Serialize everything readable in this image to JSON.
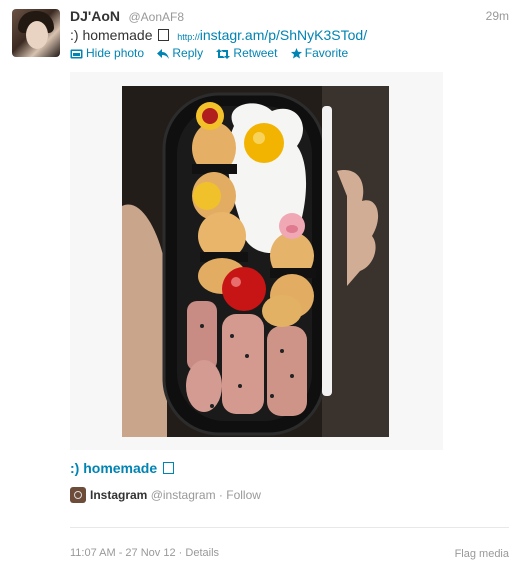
{
  "tweet": {
    "fullname": "DJ'AoN",
    "username": "@AonAF8",
    "timestamp": "29m",
    "text": ":) homemade",
    "link_prefix": "http://",
    "link_rest": "instagr.am/p/ShNyK3STod/"
  },
  "actions": {
    "hide_photo": "Hide photo",
    "reply": "Reply",
    "retweet": "Retweet",
    "favorite": "Favorite"
  },
  "media": {
    "caption": ":) homemade",
    "source_name": "Instagram",
    "source_handle": "@instagram",
    "separator": "·",
    "follow": "Follow"
  },
  "footer": {
    "time": "11:07 AM - 27 Nov 12",
    "separator": "·",
    "details": "Details",
    "flag_media": "Flag media"
  },
  "colors": {
    "link": "#0084b4",
    "muted": "#999999",
    "text": "#333333"
  },
  "icons": [
    "photo-icon",
    "reply-icon",
    "retweet-icon",
    "favorite-icon",
    "instagram-icon"
  ]
}
